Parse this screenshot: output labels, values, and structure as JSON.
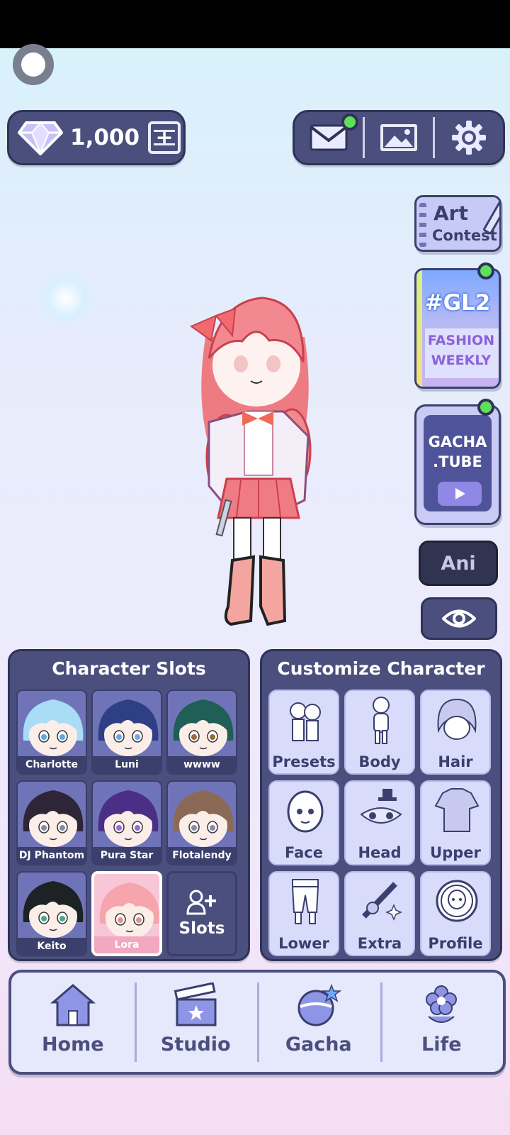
{
  "currency": {
    "amount": "1,000"
  },
  "top_right": {
    "mail_notification": true
  },
  "side": {
    "art_contest": {
      "line1": "Art",
      "line2": "Contest"
    },
    "gl2": {
      "tag": "#GL2",
      "line1": "FASHION",
      "line2": "WEEKLY"
    },
    "gachatube": {
      "line1": "GACHA",
      "line2": ".TUBE"
    },
    "ani_label": "Ani"
  },
  "slots": {
    "title": "Character Slots",
    "items": [
      {
        "name": "Charlotte",
        "hair": "#a9dcf5",
        "eyes": "#5aa8e6"
      },
      {
        "name": "Luni",
        "hair": "#2f3f85",
        "eyes": "#6ea6e8"
      },
      {
        "name": "wwww",
        "hair": "#1f5f55",
        "eyes": "#9a6a3a"
      },
      {
        "name": "DJ Phantom",
        "hair": "#2e2538",
        "eyes": "#8a8aa6"
      },
      {
        "name": "Pura Star",
        "hair": "#4b2f86",
        "eyes": "#9a6ad8"
      },
      {
        "name": "Flotalendy",
        "hair": "#8a6a56",
        "eyes": "#8a8aa6"
      },
      {
        "name": "Keito",
        "hair": "#1d2224",
        "eyes": "#4aa68e"
      },
      {
        "name": "Lora",
        "hair": "#f6a5ad",
        "eyes": "#e59090"
      }
    ],
    "add_label": "Slots"
  },
  "customize": {
    "title": "Customize Character",
    "items": [
      {
        "label": "Presets",
        "icon": "presets-icon"
      },
      {
        "label": "Body",
        "icon": "body-icon"
      },
      {
        "label": "Hair",
        "icon": "hair-icon"
      },
      {
        "label": "Face",
        "icon": "face-icon"
      },
      {
        "label": "Head",
        "icon": "head-icon"
      },
      {
        "label": "Upper",
        "icon": "upper-icon"
      },
      {
        "label": "Lower",
        "icon": "lower-icon"
      },
      {
        "label": "Extra",
        "icon": "extra-icon"
      },
      {
        "label": "Profile",
        "icon": "profile-icon"
      }
    ]
  },
  "nav": [
    {
      "label": "Home",
      "icon": "home-icon"
    },
    {
      "label": "Studio",
      "icon": "clapperboard-icon"
    },
    {
      "label": "Gacha",
      "icon": "gacha-orb-icon"
    },
    {
      "label": "Life",
      "icon": "flower-icon"
    }
  ]
}
